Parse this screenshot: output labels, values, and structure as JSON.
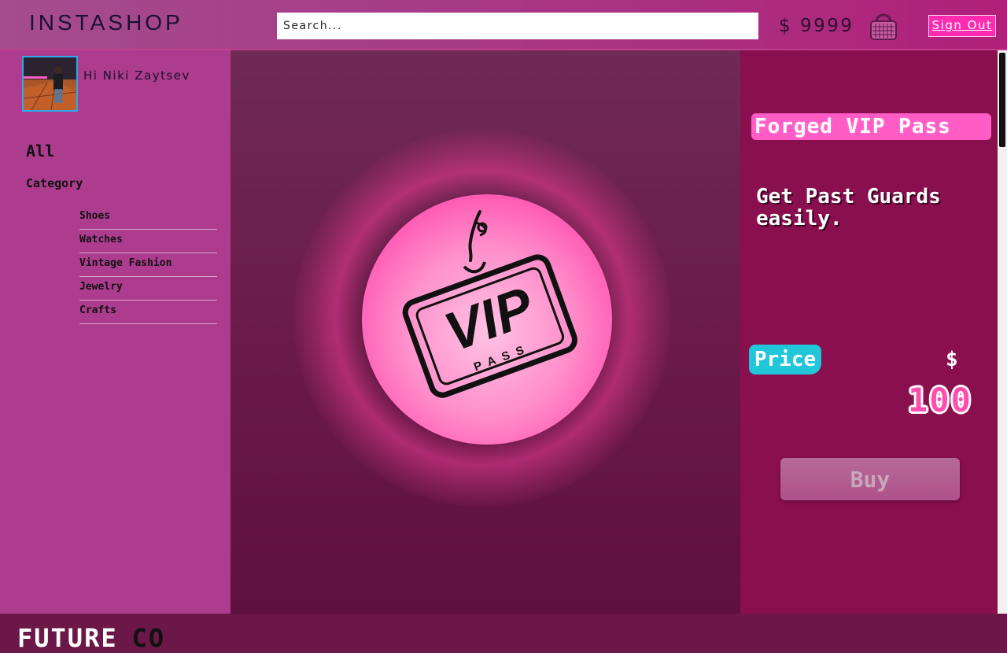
{
  "header": {
    "logo_prefix": "INSTA",
    "logo_suffix": "SHOP",
    "search_placeholder": "Search...",
    "balance": "$ 9999",
    "cart_icon": "shopping-basket-icon",
    "sign_out_label": "Sign Out"
  },
  "sidebar": {
    "greeting": "Hi Niki Zaytsev",
    "all_label": "All",
    "category_heading": "Category",
    "categories": [
      "Shoes",
      "Watches",
      "Vintage Fashion",
      "Jewelry",
      "Crafts"
    ],
    "footer_brand_left": "FUTURE",
    "footer_brand_right": "CO"
  },
  "product": {
    "image_text": "VIP",
    "image_subtext": "PASS",
    "title": "Forged VIP Pass",
    "description": "Get Past Guards easily.",
    "price_label": "Price",
    "currency": "$",
    "price": "100",
    "buy_label": "Buy"
  },
  "colors": {
    "accent_pink": "#ff2bb0",
    "price_label_bg": "#21c6d8",
    "panel_bg": "#8a0f4e",
    "sidebar_bg": "#ad3c8e"
  }
}
